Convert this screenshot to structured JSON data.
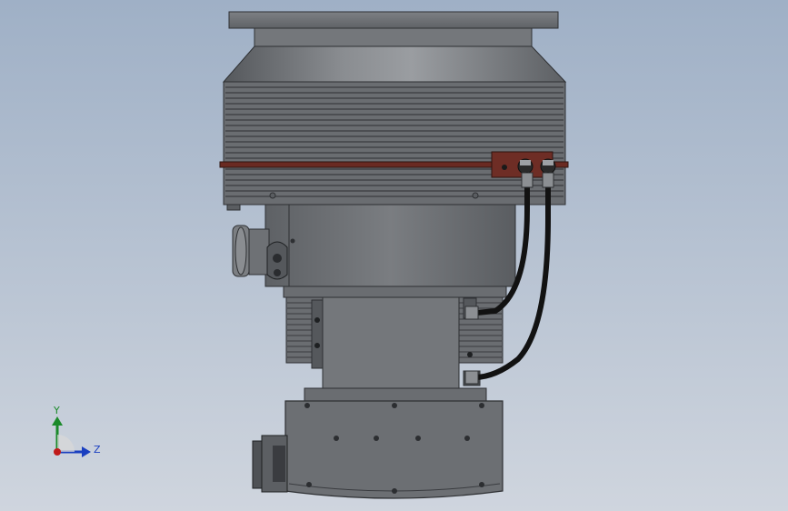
{
  "viewport": {
    "background_top": "#9fb0c6",
    "background_bottom": "#cfd5de"
  },
  "model": {
    "body_color": "#6f7276",
    "dark_color": "#3c3f43",
    "accent_color": "#6a2a22",
    "cable_color": "#121212"
  },
  "triad": {
    "y_label": "Y",
    "z_label": "Z",
    "y_color": "#1b8a2a",
    "z_color": "#1a3fc0",
    "origin_color": "#c01a1a"
  }
}
